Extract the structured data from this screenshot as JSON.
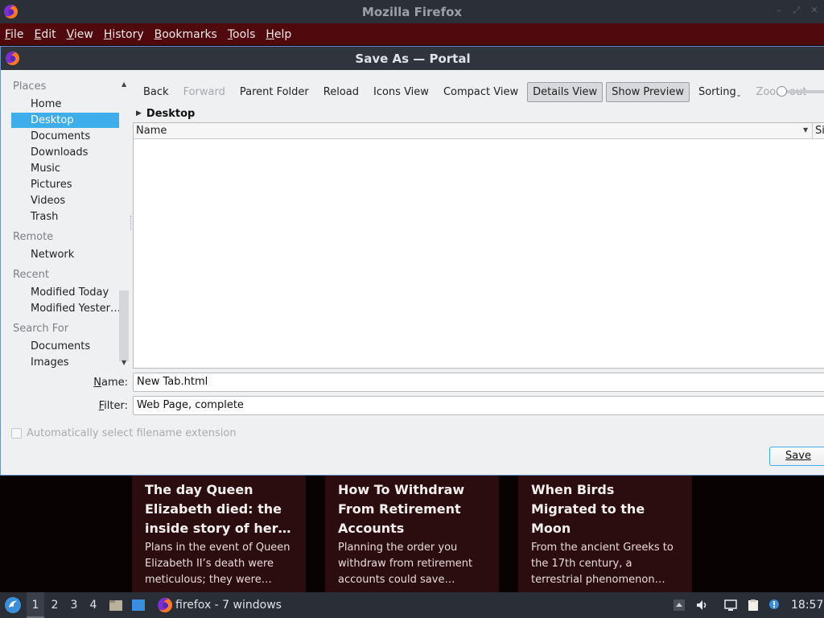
{
  "window": {
    "title": "Mozilla Firefox"
  },
  "menubar": {
    "items": [
      {
        "label": "File",
        "accel": "F",
        "rest": "ile"
      },
      {
        "label": "Edit",
        "accel": "E",
        "rest": "dit"
      },
      {
        "label": "View",
        "accel": "V",
        "rest": "iew"
      },
      {
        "label": "History",
        "accel": "H",
        "rest": "istory"
      },
      {
        "label": "Bookmarks",
        "accel": "B",
        "rest": "ookmarks"
      },
      {
        "label": "Tools",
        "accel": "T",
        "rest": "ools"
      },
      {
        "label": "Help",
        "accel": "H",
        "rest": "elp"
      }
    ]
  },
  "dialog": {
    "title": "Save As — Portal",
    "places": {
      "sections": [
        {
          "heading": "Places",
          "items": [
            "Home",
            "Desktop",
            "Documents",
            "Downloads",
            "Music",
            "Pictures",
            "Videos",
            "Trash"
          ]
        },
        {
          "heading": "Remote",
          "items": [
            "Network"
          ]
        },
        {
          "heading": "Recent",
          "items": [
            "Modified Today",
            "Modified Yester…"
          ]
        },
        {
          "heading": "Search For",
          "items": [
            "Documents",
            "Images"
          ]
        }
      ],
      "selected": "Desktop"
    },
    "toolbar": {
      "back": "Back",
      "forward": "Forward",
      "parent_folder": "Parent Folder",
      "reload": "Reload",
      "icons_view": "Icons View",
      "compact_view": "Compact View",
      "details_view": "Details View",
      "show_preview": "Show Preview",
      "sorting": "Sorting",
      "zoom_out": "Zoom out"
    },
    "breadcrumb": "Desktop",
    "filelist": {
      "columns": [
        "Name",
        "Si"
      ]
    },
    "name_label": "Name:",
    "name_accel": "N",
    "name_rest": "ame:",
    "name_value": "New Tab.html",
    "filter_label": "Filter:",
    "filter_accel": "F",
    "filter_rest": "ilter:",
    "filter_value": "Web Page, complete",
    "auto_ext_label": "Automatically select filename extension",
    "save_label": "Save"
  },
  "page_cards": [
    {
      "title": "The day Queen Elizabeth died: the inside story of her…",
      "text": "Plans in the event of Queen Elizabeth II’s death were meticulous; they were…"
    },
    {
      "title": "How To Withdraw From Retirement Accounts",
      "text": "Planning the order you withdraw from retirement accounts could save…"
    },
    {
      "title": "When Birds Migrated to the Moon",
      "text": "From the ancient Greeks to the 17th century, a terrestrial phenomenon…"
    }
  ],
  "taskbar": {
    "workspaces": [
      "1",
      "2",
      "3",
      "4"
    ],
    "active_workspace": "1",
    "app_label": "firefox - 7 windows",
    "clock": "18:57"
  },
  "colors": {
    "menubar_bg": "#500a0e",
    "selection": "#3daee9",
    "card_bg": "#2c0d0f"
  }
}
